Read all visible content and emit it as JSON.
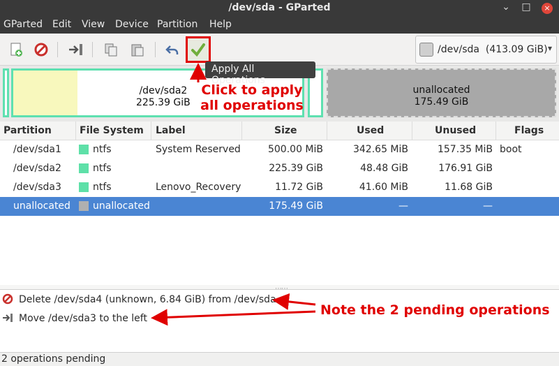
{
  "window": {
    "title": "/dev/sda - GParted",
    "minimize": "⌄",
    "maximize": "□",
    "close": "×"
  },
  "menu": [
    "GParted",
    "Edit",
    "View",
    "Device",
    "Partition",
    "Help"
  ],
  "toolbar": {
    "icons": [
      "new-partition-icon",
      "delete-icon",
      "resize-move-icon",
      "copy-icon",
      "paste-icon",
      "undo-icon",
      "apply-icon"
    ],
    "tooltip": "Apply All Operations",
    "device": "/dev/sda",
    "device_size": "(413.09 GiB)"
  },
  "diskmap": {
    "sda2_name": "/dev/sda2",
    "sda2_size": "225.39 GiB",
    "unalloc_name": "unallocated",
    "unalloc_size": "175.49 GiB"
  },
  "annotations": {
    "click1": "Click to apply",
    "click2": "all operations",
    "note": "Note the 2 pending operations"
  },
  "table": {
    "headers": [
      "Partition",
      "File System",
      "Label",
      "Size",
      "Used",
      "Unused",
      "Flags"
    ],
    "rows": [
      {
        "partition": "/dev/sda1",
        "fs": "ntfs",
        "label": "System Reserved",
        "size": "500.00 MiB",
        "used": "342.65 MiB",
        "unused": "157.35 MiB",
        "flags": "boot",
        "color": "#5ee0a8"
      },
      {
        "partition": "/dev/sda2",
        "fs": "ntfs",
        "label": "",
        "size": "225.39 GiB",
        "used": "48.48 GiB",
        "unused": "176.91 GiB",
        "flags": "",
        "color": "#5ee0a8"
      },
      {
        "partition": "/dev/sda3",
        "fs": "ntfs",
        "label": "Lenovo_Recovery",
        "size": "11.72 GiB",
        "used": "41.60 MiB",
        "unused": "11.68 GiB",
        "flags": "",
        "color": "#5ee0a8"
      },
      {
        "partition": "unallocated",
        "fs": "unallocated",
        "label": "",
        "size": "175.49 GiB",
        "used": "—",
        "unused": "—",
        "flags": "",
        "color": "#b0b0b0"
      }
    ]
  },
  "operations": [
    {
      "icon": "delete-icon",
      "text": "Delete /dev/sda4 (unknown, 6.84 GiB) from /dev/sda"
    },
    {
      "icon": "move-icon",
      "text": "Move /dev/sda3 to the left"
    }
  ],
  "status": "2 operations pending",
  "colors": {
    "accent_red": "#e00000",
    "selection": "#4a85d3",
    "ntfs": "#5ee0a8",
    "unallocated": "#a8a8a8"
  }
}
